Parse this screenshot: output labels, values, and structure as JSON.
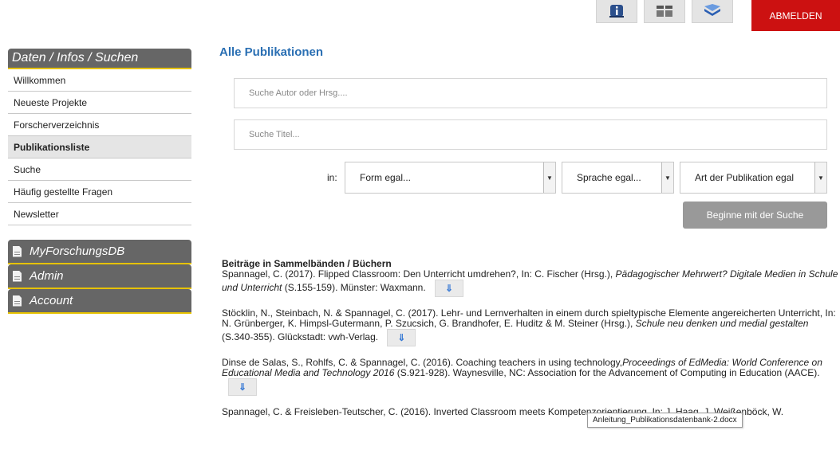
{
  "header": {
    "logout_label": "ABMELDEN",
    "tools": [
      {
        "icon": "info-icon"
      },
      {
        "icon": "grid-icon"
      },
      {
        "icon": "book-icon"
      }
    ]
  },
  "sidebar": {
    "heading": "Daten / Infos / Suchen",
    "items": [
      {
        "label": "Willkommen"
      },
      {
        "label": "Neueste Projekte"
      },
      {
        "label": "Forscherverzeichnis"
      },
      {
        "label": "Publikationsliste"
      },
      {
        "label": "Suche"
      },
      {
        "label": "Häufig gestellte Fragen"
      },
      {
        "label": "Newsletter"
      }
    ],
    "blocks": [
      {
        "label": "MyForschungsDB"
      },
      {
        "label": "Admin"
      },
      {
        "label": "Account"
      }
    ]
  },
  "main": {
    "title": "Alle Publikationen",
    "author_placeholder": "Suche Autor oder Hrsg....",
    "title_placeholder": "Suche Titel...",
    "in_label": "in:",
    "form_select": "Form egal...",
    "language_select": "Sprache egal...",
    "type_select": "Art der Publikation egal",
    "search_button": "Beginne mit der Suche"
  },
  "results": {
    "section_title": "Beiträge in Sammelbänden / Büchern",
    "entries": [
      {
        "plain": "Spannagel, C. (2017). Flipped Classroom: Den Unterricht umdrehen?, In: C. Fischer (Hrsg.), ",
        "italic": "Pädagogischer Mehrwert? Digitale Medien in Schule und Unterricht",
        "tail": " (S.155-159). Münster: Waxmann."
      },
      {
        "plain": "Stöcklin, N., Steinbach, N. & Spannagel, C. (2017). Lehr- und Lernverhalten in einem durch spieltypische Elemente angereicherten Unterricht, In: N. Grünberger, K. Himpsl-Gutermann, P. Szucsich, G. Brandhofer, E. Huditz & M. Steiner (Hrsg.), ",
        "italic": "Schule neu denken und medial gestalten",
        "tail": " (S.340-355). Glückstadt: vwh-Verlag."
      },
      {
        "plain": "Dinse de Salas, S., Rohlfs, C. & Spannagel, C. (2016). Coaching teachers in using technology,",
        "italic": "Proceedings of EdMedia: World Conference on Educational Media and Technology 2016",
        "tail": " (S.921-928). Waynesville, NC: Association for the Advancement of Computing in Education (AACE)."
      },
      {
        "plain": "Spannagel, C. & Freisleben-Teutscher, C. (2016). Inverted Classroom meets Kompetenzorientierung, In: J. Haag, J. Weißenböck, W.",
        "italic": "",
        "tail": ""
      }
    ],
    "tooltip": "Anleitung_Publikationsdatenbank-2.docx"
  }
}
